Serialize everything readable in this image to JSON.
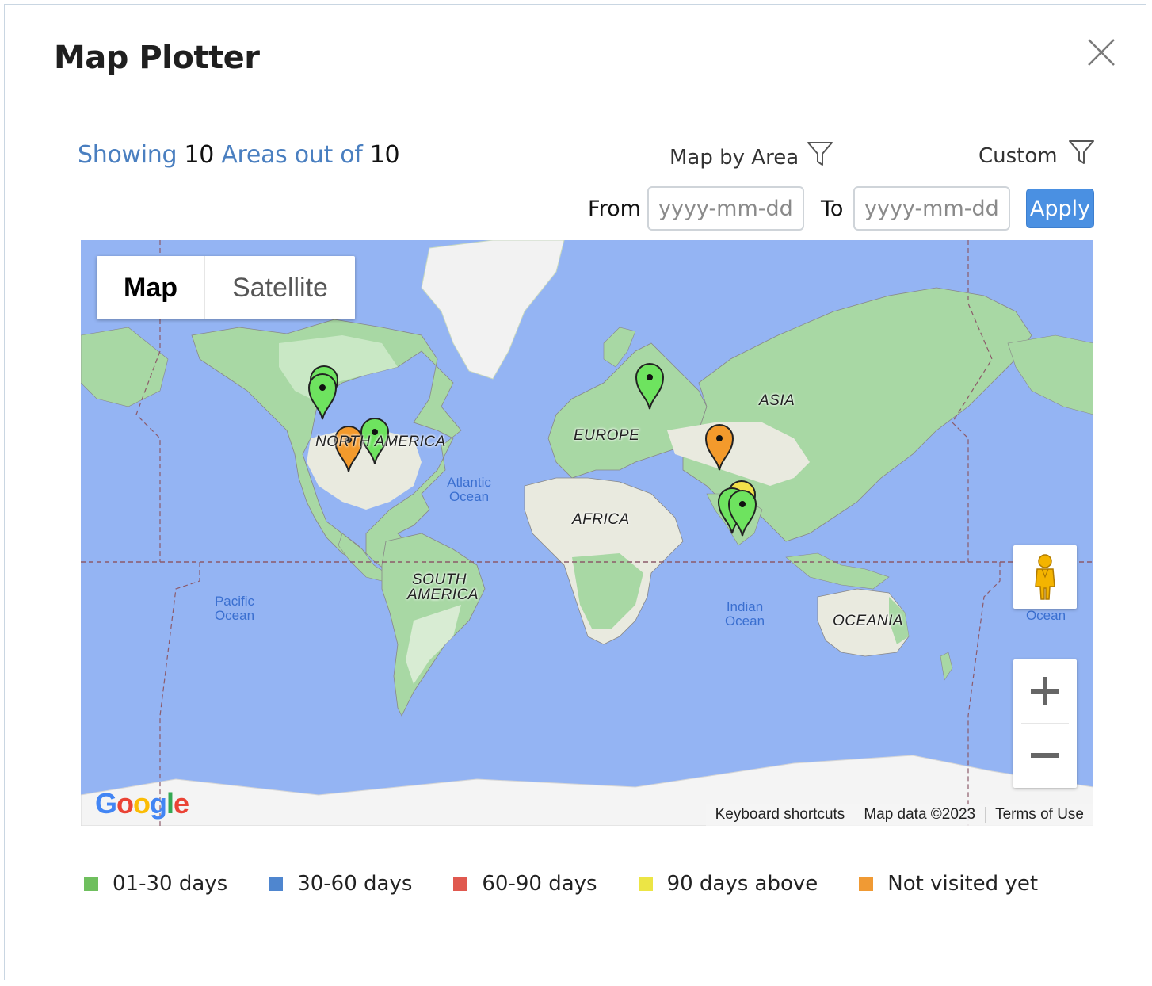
{
  "dialog": {
    "title": "Map Plotter",
    "close_icon": "close-icon"
  },
  "summary": {
    "showing_label": "Showing",
    "shown_count": "10",
    "areas_label": "Areas out of",
    "total_count": "10"
  },
  "filters": {
    "map_by_label": "Map by Area",
    "custom_label": "Custom",
    "filter_icon": "funnel-icon",
    "from_label": "From",
    "from_placeholder": "yyyy-mm-dd",
    "to_label": "To",
    "to_placeholder": "yyyy-mm-dd",
    "apply_label": "Apply"
  },
  "map": {
    "type_options": [
      "Map",
      "Satellite"
    ],
    "selected_type": "Map",
    "labels": {
      "north_america": "NORTH AMERICA",
      "south_america_1": "SOUTH",
      "south_america_2": "AMERICA",
      "europe": "EUROPE",
      "africa": "AFRICA",
      "asia": "ASIA",
      "oceania": "OCEANIA",
      "atlantic_1": "Atlantic",
      "atlantic_2": "Ocean",
      "pacific_1": "Pacific",
      "pacific_2": "Ocean",
      "indian_1": "Indian",
      "indian_2": "Ocean",
      "ocean_right": "Ocean"
    },
    "footer": {
      "keyboard": "Keyboard shortcuts",
      "map_data": "Map data ©2023",
      "terms": "Terms of Use"
    },
    "logo_text": "Google",
    "zoom_in_icon": "plus-icon",
    "zoom_out_icon": "minus-icon",
    "pegman_icon": "street-view-icon",
    "marker_colors": {
      "green": "#6ee35f",
      "orange": "#f39a2c",
      "yellow": "#f3e14a"
    }
  },
  "legend": [
    {
      "label": "01-30 days",
      "color": "#6fbf5e"
    },
    {
      "label": "30-60 days",
      "color": "#4f86cf"
    },
    {
      "label": "60-90 days",
      "color": "#e0594f"
    },
    {
      "label": "90 days above",
      "color": "#ece545"
    },
    {
      "label": "Not visited yet",
      "color": "#f09a34"
    }
  ]
}
